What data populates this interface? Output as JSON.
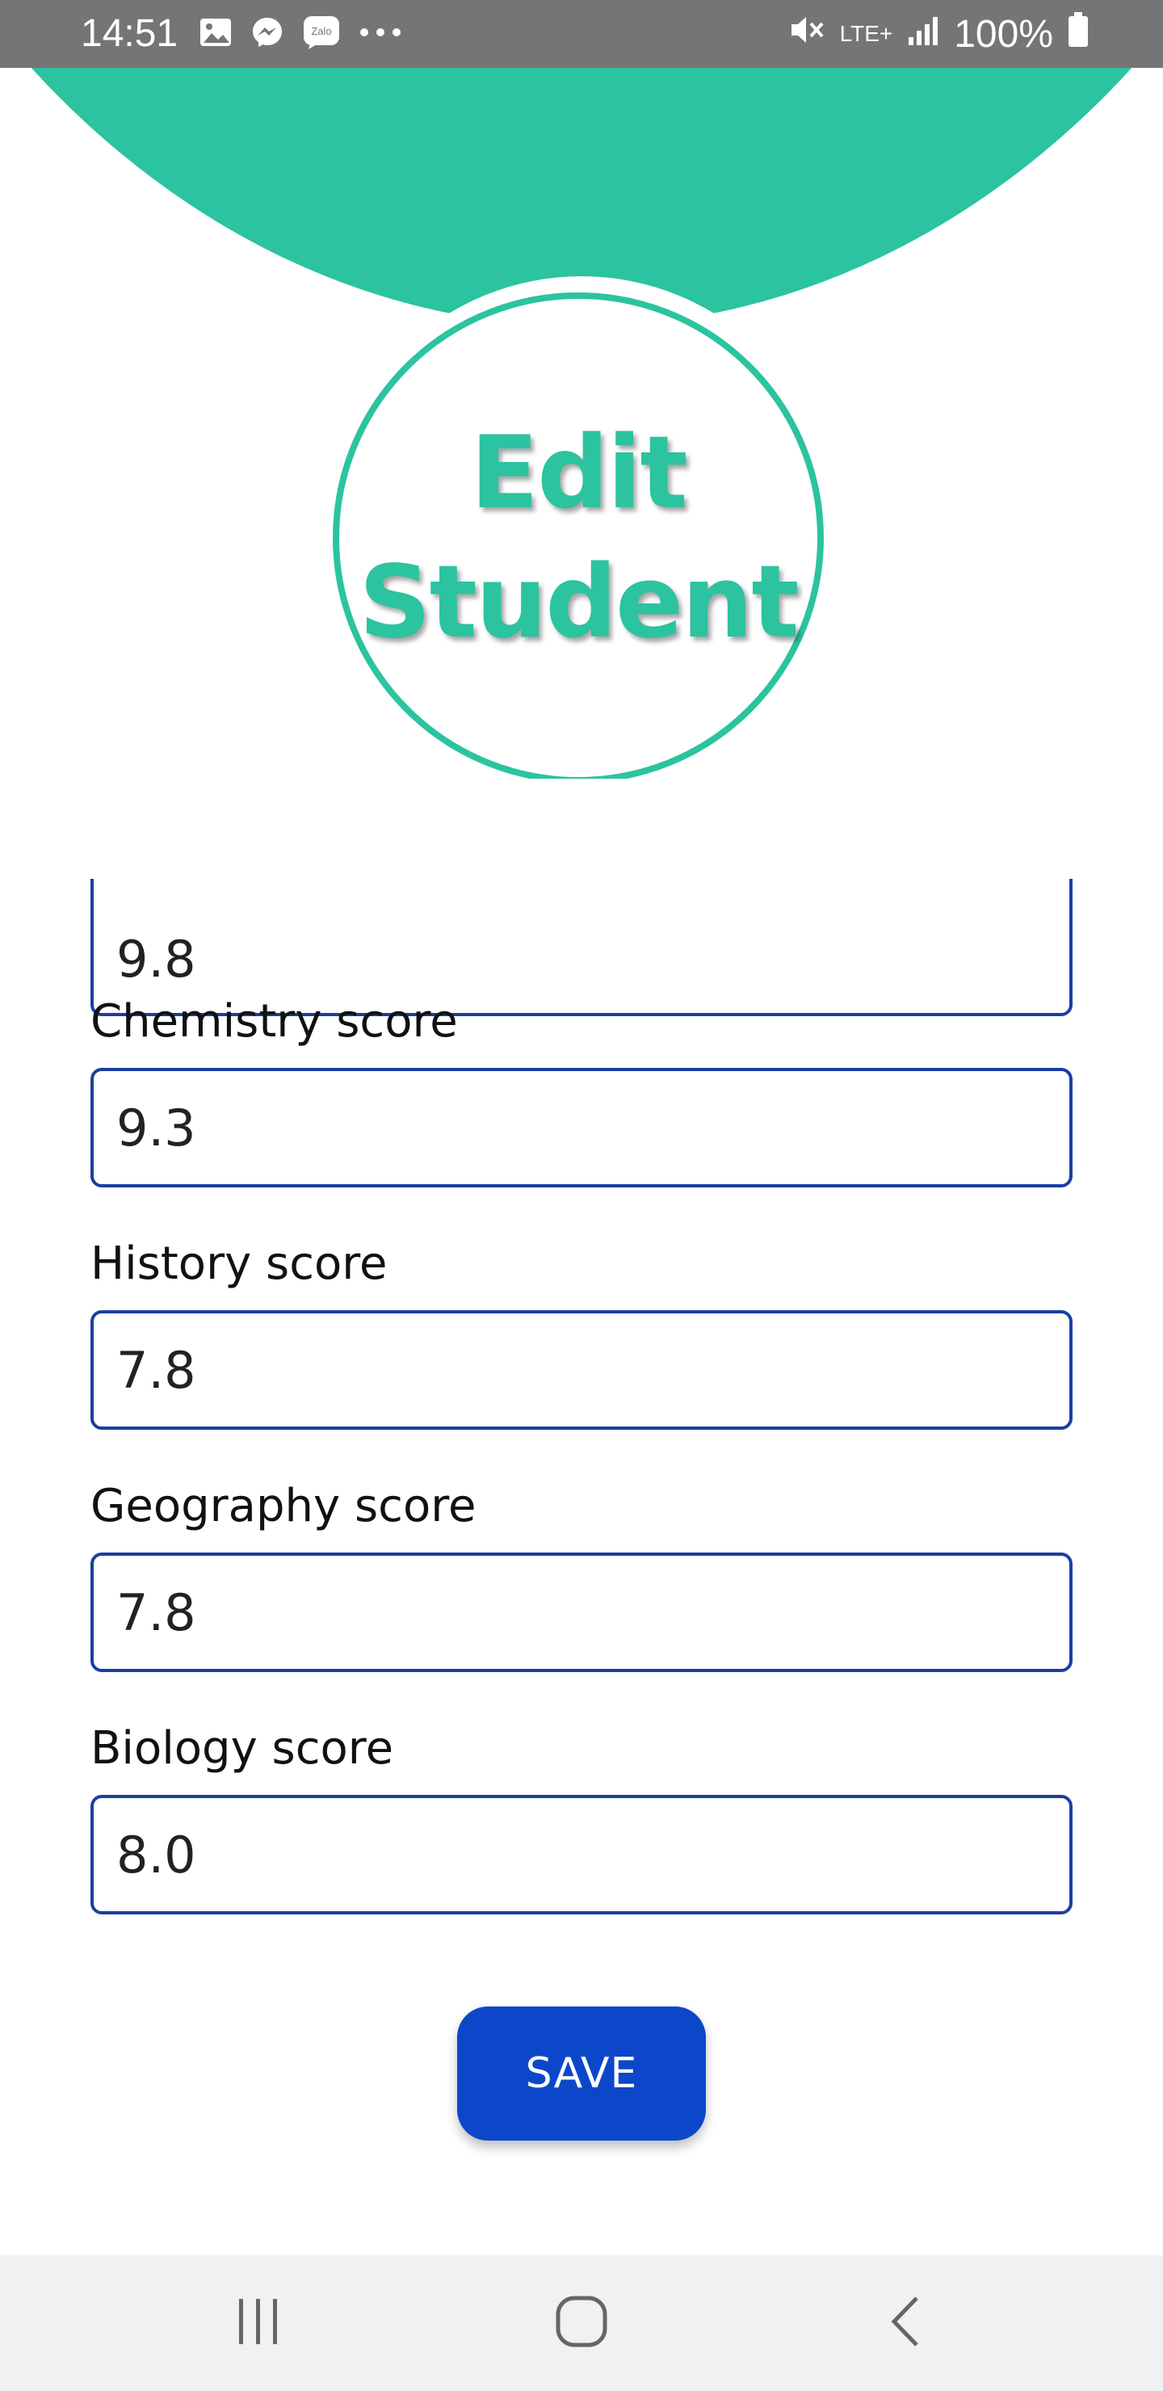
{
  "status_bar": {
    "time": "14:51",
    "left_icons": [
      "image-icon",
      "messenger-icon",
      "zalo-icon",
      "more-dots-icon"
    ],
    "zalo_label": "Zalo",
    "network_label": "LTE+",
    "battery": "100%",
    "right_icons": [
      "mute-icon",
      "signal-icon",
      "battery-icon"
    ]
  },
  "header": {
    "title_line1": "Edit",
    "title_line2": "Student",
    "accent_color": "#2bc3a0"
  },
  "form": {
    "partial_field_value": "9.8",
    "fields": [
      {
        "label": "Chemistry score",
        "value": "9.3"
      },
      {
        "label": "History score",
        "value": "7.8"
      },
      {
        "label": "Geography score",
        "value": "7.8"
      },
      {
        "label": "Biology score",
        "value": "8.0"
      }
    ],
    "border_color": "#1a3fa0"
  },
  "actions": {
    "save_label": "SAVE",
    "button_color": "#0d47c9"
  },
  "nav_bar": {
    "buttons": [
      "recent-apps-icon",
      "home-icon",
      "back-icon"
    ]
  }
}
